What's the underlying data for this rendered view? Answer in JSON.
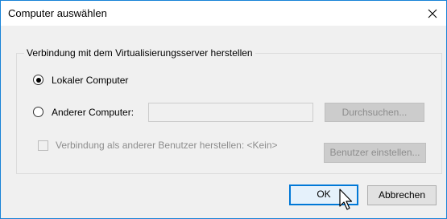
{
  "window": {
    "title": "Computer auswählen"
  },
  "group": {
    "label": "Verbindung mit dem Virtualisierungsserver herstellen",
    "local_radio": {
      "label": "Lokaler Computer",
      "checked": true
    },
    "other_radio": {
      "label": "Anderer Computer:",
      "checked": false
    },
    "computer_input": {
      "value": "",
      "placeholder": ""
    },
    "browse_button": "Durchsuchen...",
    "other_user_checkbox": {
      "label": "Verbindung als anderer Benutzer herstellen: <Kein>",
      "checked": false
    },
    "set_user_button": "Benutzer einstellen..."
  },
  "buttons": {
    "ok": "OK",
    "cancel": "Abbrechen"
  },
  "colors": {
    "accent": "#0078d7",
    "border": "#1883d7",
    "background": "#f0f0f0"
  }
}
